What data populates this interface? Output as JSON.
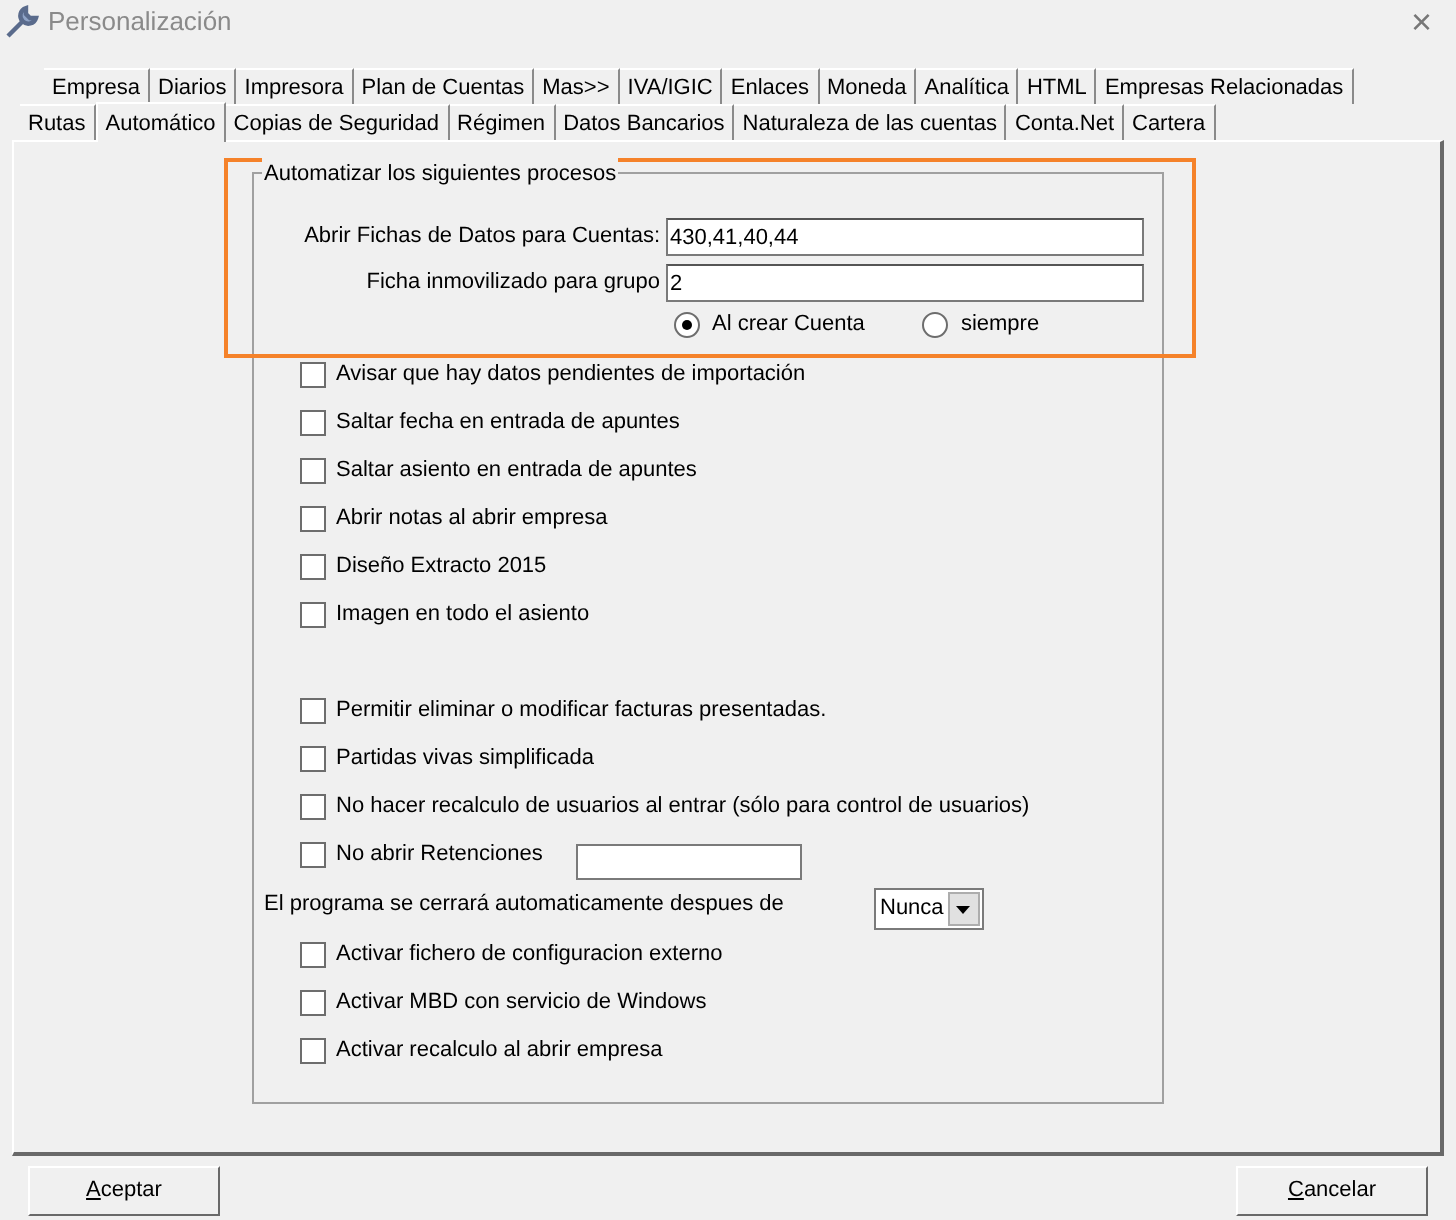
{
  "window": {
    "title": "Personalización",
    "close": "×"
  },
  "tab_rows": [
    {
      "tabs": [
        {
          "label": "Empresa",
          "selected": false
        },
        {
          "label": "Diarios",
          "selected": false
        },
        {
          "label": "Impresora",
          "selected": false
        },
        {
          "label": "Plan de Cuentas",
          "selected": false
        },
        {
          "label": "Mas>>",
          "selected": false
        },
        {
          "label": "IVA/IGIC",
          "selected": false
        },
        {
          "label": "Enlaces",
          "selected": false
        },
        {
          "label": "Moneda",
          "selected": false
        },
        {
          "label": "Analítica",
          "selected": false
        },
        {
          "label": "HTML",
          "selected": false
        },
        {
          "label": "Empresas Relacionadas",
          "selected": false
        }
      ]
    },
    {
      "tabs": [
        {
          "label": "Rutas",
          "selected": false
        },
        {
          "label": "Automático",
          "selected": true
        },
        {
          "label": "Copias de Seguridad",
          "selected": false
        },
        {
          "label": "Régimen",
          "selected": false
        },
        {
          "label": "Datos Bancarios",
          "selected": false
        },
        {
          "label": "Naturaleza de las cuentas",
          "selected": false
        },
        {
          "label": "Conta.Net",
          "selected": false
        },
        {
          "label": "Cartera",
          "selected": false
        }
      ]
    }
  ],
  "group": {
    "title": "Automatizar los siguientes procesos",
    "highlighted": true,
    "fields": [
      {
        "label": "Abrir Fichas de Datos para Cuentas:",
        "value": "430,41,40,44"
      },
      {
        "label": "Ficha inmovilizado para grupo",
        "value": "2"
      }
    ],
    "radios": [
      {
        "label": "Al crear Cuenta",
        "selected": true
      },
      {
        "label": "siempre",
        "selected": false
      }
    ]
  },
  "option_groups": [
    [
      {
        "kind": "checkbox",
        "label": "Avisar que hay datos pendientes de importación",
        "checked": false
      },
      {
        "kind": "checkbox",
        "label": "Saltar fecha en entrada de apuntes",
        "checked": false
      },
      {
        "kind": "checkbox",
        "label": "Saltar asiento en entrada de apuntes",
        "checked": false
      },
      {
        "kind": "checkbox",
        "label": "Abrir notas al abrir empresa",
        "checked": false
      },
      {
        "kind": "checkbox",
        "label": "Diseño Extracto 2015",
        "checked": false
      },
      {
        "kind": "checkbox",
        "label": "Imagen en todo el asiento",
        "checked": false
      }
    ],
    [
      {
        "kind": "checkbox",
        "label": "Permitir eliminar o modificar facturas presentadas.",
        "checked": false
      },
      {
        "kind": "checkbox",
        "label": "Partidas vivas simplificada",
        "checked": false
      },
      {
        "kind": "checkbox",
        "label": "No hacer recalculo de usuarios al entrar (sólo para control de usuarios)",
        "checked": false
      },
      {
        "kind": "checkbox_field",
        "label": "No abrir Retenciones",
        "checked": false
      },
      {
        "kind": "select",
        "label": "El programa se cerrará automaticamente despues de",
        "value": "Nunca"
      },
      {
        "kind": "checkbox",
        "label": "Activar fichero de configuracion externo",
        "checked": false
      },
      {
        "kind": "checkbox",
        "label": "Activar MBD con servicio de Windows",
        "checked": false
      },
      {
        "kind": "checkbox",
        "label": "Activar recalculo al abrir empresa",
        "checked": false
      }
    ]
  ],
  "buttons": [
    {
      "label": "Aceptar"
    },
    {
      "label": "Cancelar"
    }
  ]
}
